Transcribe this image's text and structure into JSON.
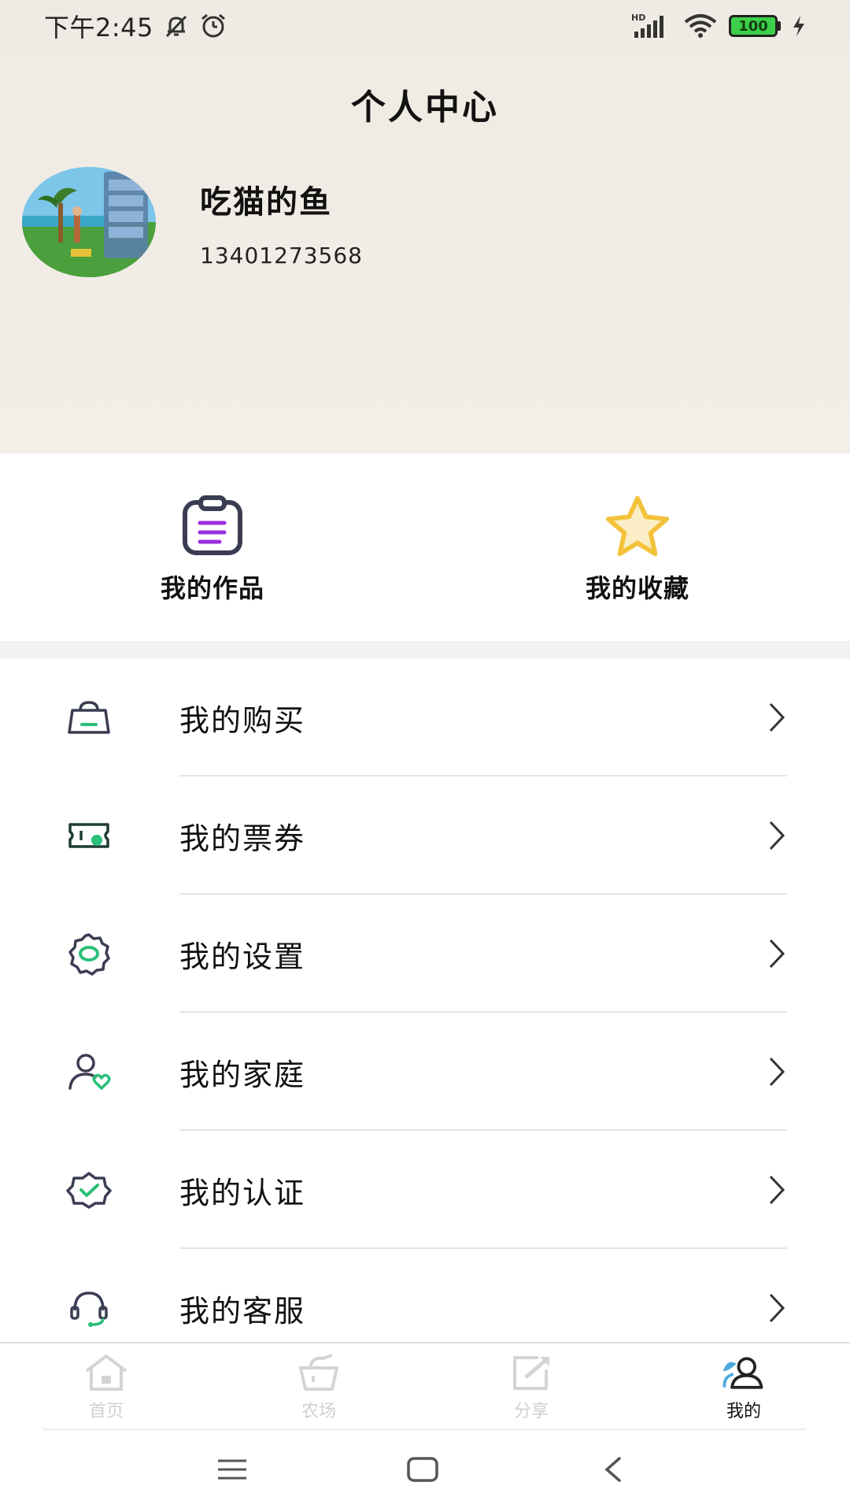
{
  "status_bar": {
    "time": "下午2:45",
    "network_label": "HD",
    "battery_level": "100"
  },
  "header": {
    "title": "个人中心"
  },
  "profile": {
    "name": "吃猫的鱼",
    "phone": "13401273568"
  },
  "quick_actions": [
    {
      "label": "我的作品",
      "icon": "clipboard-icon"
    },
    {
      "label": "我的收藏",
      "icon": "star-icon"
    }
  ],
  "menu": [
    {
      "label": "我的购买",
      "icon": "shopping-bag-icon"
    },
    {
      "label": "我的票券",
      "icon": "ticket-icon"
    },
    {
      "label": "我的设置",
      "icon": "gear-icon"
    },
    {
      "label": "我的家庭",
      "icon": "family-heart-icon"
    },
    {
      "label": "我的认证",
      "icon": "verified-badge-icon"
    },
    {
      "label": "我的客服",
      "icon": "headset-icon"
    }
  ],
  "bottom_nav": [
    {
      "label": "首页",
      "icon": "home-icon",
      "active": false
    },
    {
      "label": "农场",
      "icon": "basket-icon",
      "active": false
    },
    {
      "label": "分享",
      "icon": "share-icon",
      "active": false
    },
    {
      "label": "我的",
      "icon": "user-icon",
      "active": true
    }
  ],
  "colors": {
    "accent_green": "#2bbf7a",
    "accent_purple": "#8a2be2",
    "star_yellow": "#f5c542",
    "inactive_gray": "#d0d0d0",
    "header_bg": "#efebe4"
  }
}
